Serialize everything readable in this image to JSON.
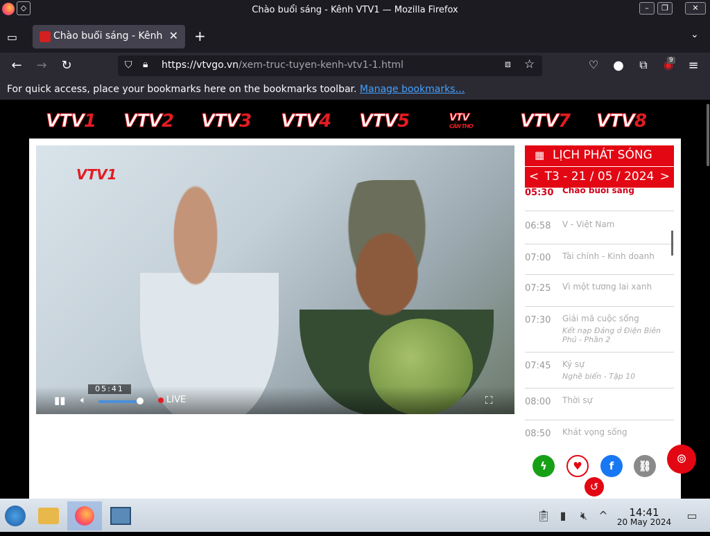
{
  "window": {
    "title": "Chào buổi sáng - Kênh VTV1 — Mozilla Firefox",
    "minimize": "–",
    "maximize": "❐",
    "close": "✕"
  },
  "tab": {
    "label": "Chào buổi sáng - Kênh V",
    "close": "✕",
    "new_tab": "+"
  },
  "nav": {
    "url_host": "https://vtvgo.vn",
    "url_path": "/xem-truc-tuyen-kenh-vtv1-1.html",
    "extensions_badge": "9"
  },
  "bookmarks_bar": {
    "text": "For quick access, place your bookmarks here on the bookmarks toolbar.",
    "link": "Manage bookmarks…"
  },
  "channels": [
    {
      "prefix": "VTV",
      "num": "1"
    },
    {
      "prefix": "VTV",
      "num": "2"
    },
    {
      "prefix": "VTV",
      "num": "3"
    },
    {
      "prefix": "VTV",
      "num": "4"
    },
    {
      "prefix": "VTV",
      "num": "5"
    },
    {
      "prefix": "VTV",
      "num": "CẦN THƠ"
    },
    {
      "prefix": "VTV",
      "num": "7"
    },
    {
      "prefix": "VTV",
      "num": "8"
    }
  ],
  "player": {
    "logo": "VTV1",
    "time": "05:41",
    "live_label": "LIVE",
    "volume": 0.9
  },
  "schedule": {
    "heading": "LỊCH PHÁT SÓNG",
    "date": "T3 - 21 / 05 / 2024",
    "prev": "<",
    "next": ">",
    "items": [
      {
        "time": "05:30",
        "name": "Chào buổi sáng",
        "sub": "",
        "current": true
      },
      {
        "time": "06:58",
        "name": "V - Việt Nam",
        "sub": ""
      },
      {
        "time": "07:00",
        "name": "Tài chính - Kinh doanh",
        "sub": ""
      },
      {
        "time": "07:25",
        "name": "Vì một tương lai xanh",
        "sub": ""
      },
      {
        "time": "07:30",
        "name": "Giải mã cuộc sống",
        "sub": "Kết nạp Đảng ở Điện Biên Phủ - Phần 2"
      },
      {
        "time": "07:45",
        "name": "Ký sự",
        "sub": "Nghề biển - Tập 10"
      },
      {
        "time": "08:00",
        "name": "Thời sự",
        "sub": ""
      },
      {
        "time": "08:50",
        "name": "Khát vọng sống",
        "sub": ""
      }
    ]
  },
  "taskbar": {
    "time": "14:41",
    "date": "20 May 2024"
  },
  "colors": {
    "brand_red": "#e30613",
    "green": "#17a016",
    "facebook": "#1877f2",
    "gray": "#8a8a8a"
  }
}
